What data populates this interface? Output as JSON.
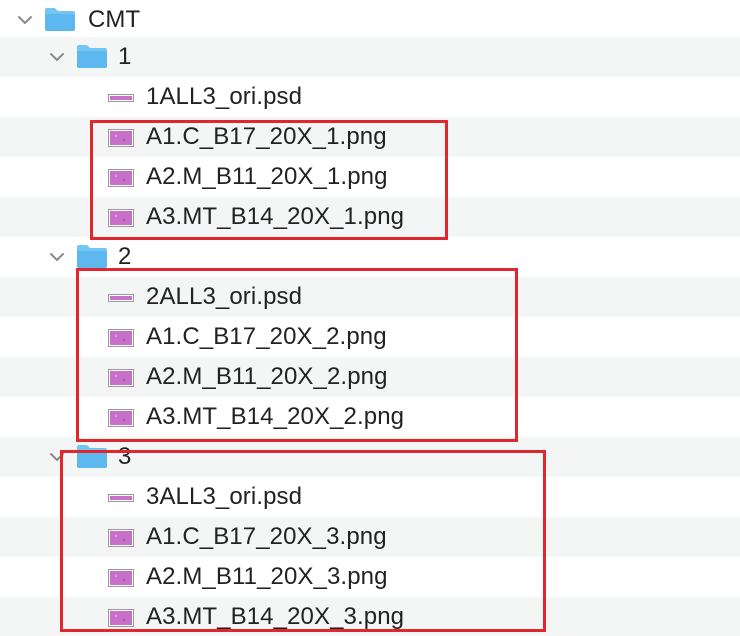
{
  "tree": {
    "root": {
      "name": "CMT",
      "expanded": true,
      "icon": "folder-icon"
    },
    "folders": [
      {
        "name": "1",
        "expanded": true,
        "files": [
          {
            "name": "1ALL3_ori.psd",
            "icon": "psd-thumbnail-icon"
          },
          {
            "name": "A1.C_B17_20X_1.png",
            "icon": "png-thumbnail-icon"
          },
          {
            "name": "A2.M_B11_20X_1.png",
            "icon": "png-thumbnail-icon"
          },
          {
            "name": "A3.MT_B14_20X_1.png",
            "icon": "png-thumbnail-icon"
          }
        ]
      },
      {
        "name": "2",
        "expanded": true,
        "files": [
          {
            "name": "2ALL3_ori.psd",
            "icon": "psd-thumbnail-icon"
          },
          {
            "name": "A1.C_B17_20X_2.png",
            "icon": "png-thumbnail-icon"
          },
          {
            "name": "A2.M_B11_20X_2.png",
            "icon": "png-thumbnail-icon"
          },
          {
            "name": "A3.MT_B14_20X_2.png",
            "icon": "png-thumbnail-icon"
          }
        ]
      },
      {
        "name": "3",
        "expanded": true,
        "files": [
          {
            "name": "3ALL3_ori.psd",
            "icon": "psd-thumbnail-icon"
          },
          {
            "name": "A1.C_B17_20X_3.png",
            "icon": "png-thumbnail-icon"
          },
          {
            "name": "A2.M_B11_20X_3.png",
            "icon": "png-thumbnail-icon"
          },
          {
            "name": "A3.MT_B14_20X_3.png",
            "icon": "png-thumbnail-icon"
          }
        ]
      }
    ]
  },
  "colors": {
    "highlight_border": "#e0262e",
    "alt_row": "#f4f5f5",
    "folder_body": "#5cb8ee",
    "folder_tab": "#74c6f2",
    "thumbnail": "#c76fc9"
  }
}
